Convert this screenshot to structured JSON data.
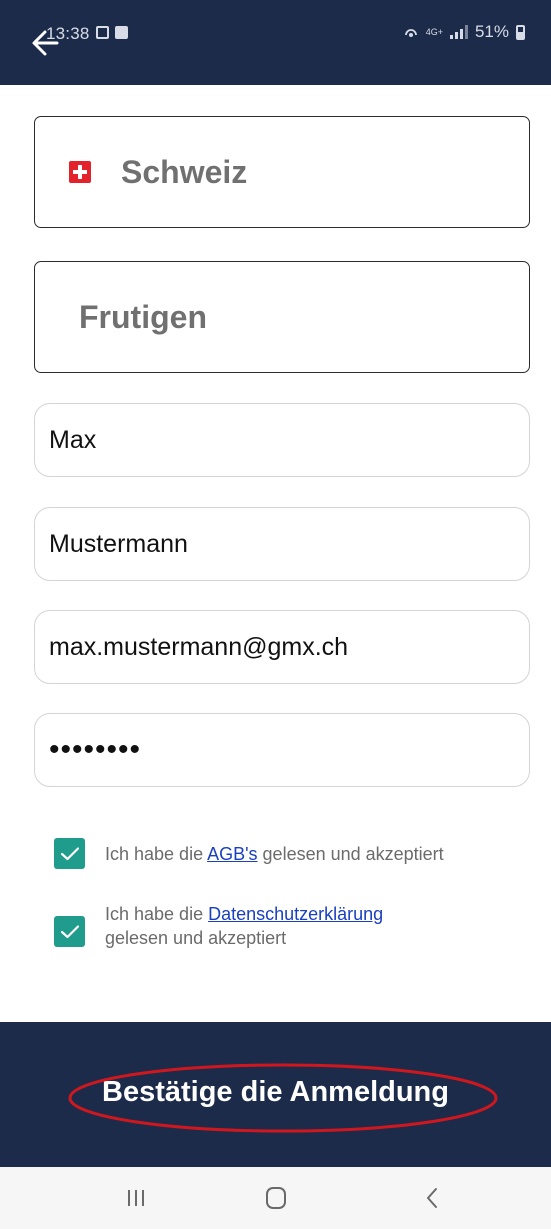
{
  "status_bar": {
    "time": "13:38",
    "battery_text": "51%",
    "network_label": "4G+",
    "icons": [
      "hotspot-icon",
      "signal-icon",
      "battery-icon",
      "notification-icon",
      "gallery-icon"
    ]
  },
  "header": {
    "back_icon": "arrow-left-icon"
  },
  "form": {
    "country": "Schweiz",
    "country_flag": "swiss-flag-icon",
    "city": "Frutigen",
    "first_name": "Max",
    "last_name": "Mustermann",
    "email": "max.mustermann@gmx.ch",
    "password": "••••••••"
  },
  "consents": {
    "agb": {
      "prefix": "Ich habe die ",
      "link": "AGB's",
      "suffix": " gelesen und akzeptiert",
      "checked": true
    },
    "privacy": {
      "prefix": "Ich habe die ",
      "link": "Datenschutzerklärung",
      "suffix": "gelesen und akzeptiert",
      "checked": true
    }
  },
  "action": {
    "submit_label": "Bestätige die Anmeldung"
  },
  "colors": {
    "header_bg": "#1c2b4a",
    "checkbox": "#1f9c8c",
    "link": "#1a3fbf",
    "annotation": "#d0171e"
  },
  "nav": {
    "recent_icon": "recent-apps-icon",
    "home_icon": "home-icon",
    "back_icon": "back-chevron-icon"
  }
}
